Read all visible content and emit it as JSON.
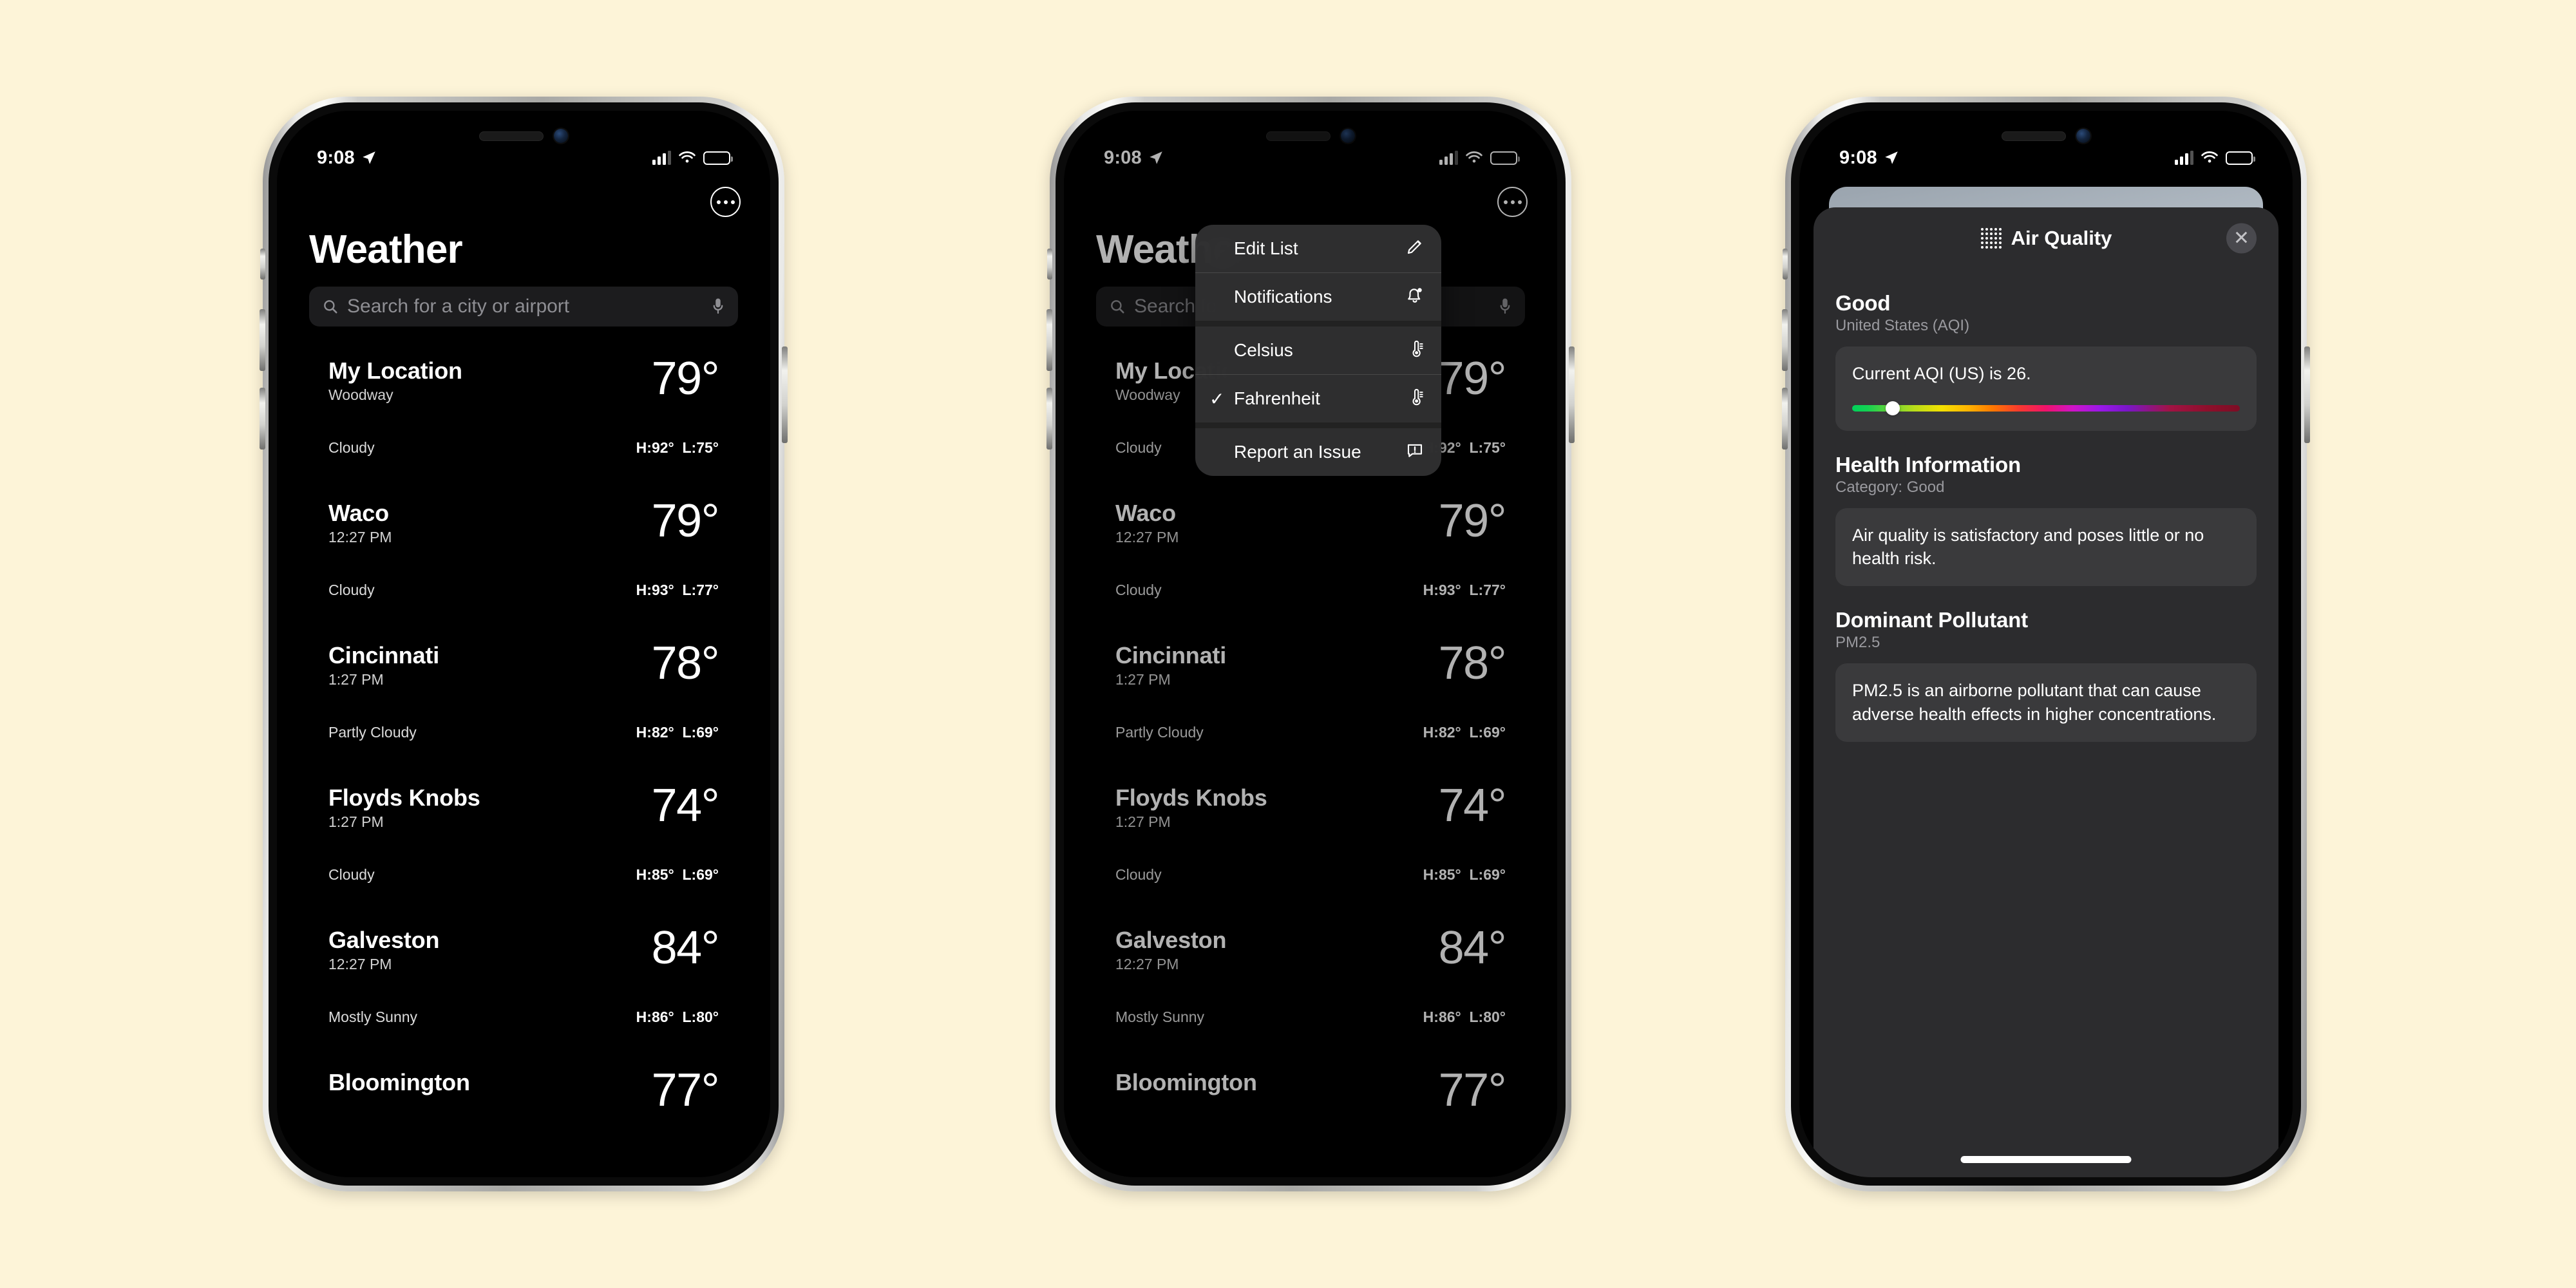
{
  "background_color": "#fdf4d8",
  "status_bar": {
    "time": "9:08",
    "location_icon": "location-arrow-icon",
    "cellular_icon": "cellular-bars-icon",
    "wifi_icon": "wifi-icon",
    "battery_icon": "battery-icon"
  },
  "weather_app": {
    "title": "Weather",
    "more_button_label": "more-options",
    "search": {
      "placeholder": "Search for a city or airport",
      "search_icon": "search-icon",
      "mic_icon": "microphone-icon"
    },
    "cards": [
      {
        "city": "My Location",
        "sub": "Woodway",
        "temp": "79°",
        "condition": "Cloudy",
        "high": "H:92°",
        "low": "L:75°",
        "style": "bg-cloudy"
      },
      {
        "city": "Waco",
        "sub": "12:27 PM",
        "temp": "79°",
        "condition": "Cloudy",
        "high": "H:93°",
        "low": "L:77°",
        "style": "bg-cloudy2"
      },
      {
        "city": "Cincinnati",
        "sub": "1:27 PM",
        "temp": "78°",
        "condition": "Partly Cloudy",
        "high": "H:82°",
        "low": "L:69°",
        "style": "bg-partly"
      },
      {
        "city": "Floyds Knobs",
        "sub": "1:27 PM",
        "temp": "74°",
        "condition": "Cloudy",
        "high": "H:85°",
        "low": "L:69°",
        "style": "bg-cloudy3"
      },
      {
        "city": "Galveston",
        "sub": "12:27 PM",
        "temp": "84°",
        "condition": "Mostly Sunny",
        "high": "H:86°",
        "low": "L:80°",
        "style": "bg-sunny"
      },
      {
        "city": "Bloomington",
        "sub": "",
        "temp": "77°",
        "condition": "",
        "high": "",
        "low": "",
        "style": "bg-sunny"
      }
    ]
  },
  "context_menu": {
    "items": [
      {
        "label": "Edit List",
        "icon": "pencil-icon",
        "checked": ""
      },
      {
        "label": "Notifications",
        "icon": "bell-icon",
        "checked": ""
      },
      {
        "label": "Celsius",
        "icon": "thermometer-icon",
        "checked": ""
      },
      {
        "label": "Fahrenheit",
        "icon": "thermometer-icon",
        "checked": "✓"
      },
      {
        "label": "Report an Issue",
        "icon": "report-bubble-icon",
        "checked": ""
      }
    ]
  },
  "air_quality": {
    "title": "Air Quality",
    "dots_icon": "air-quality-dots-icon",
    "close_label": "✕",
    "category": "Good",
    "scale": "United States (AQI)",
    "current_text": "Current AQI (US) is 26.",
    "aqi_value": 26,
    "aqi_position_percent": 10.5,
    "health_title": "Health Information",
    "health_sub": "Category: Good",
    "health_text": "Air quality is satisfactory and poses little or no health risk.",
    "pollutant_title": "Dominant Pollutant",
    "pollutant_sub": "PM2.5",
    "pollutant_text": "PM2.5 is an airborne pollutant that can cause adverse health effects in higher concentrations."
  }
}
